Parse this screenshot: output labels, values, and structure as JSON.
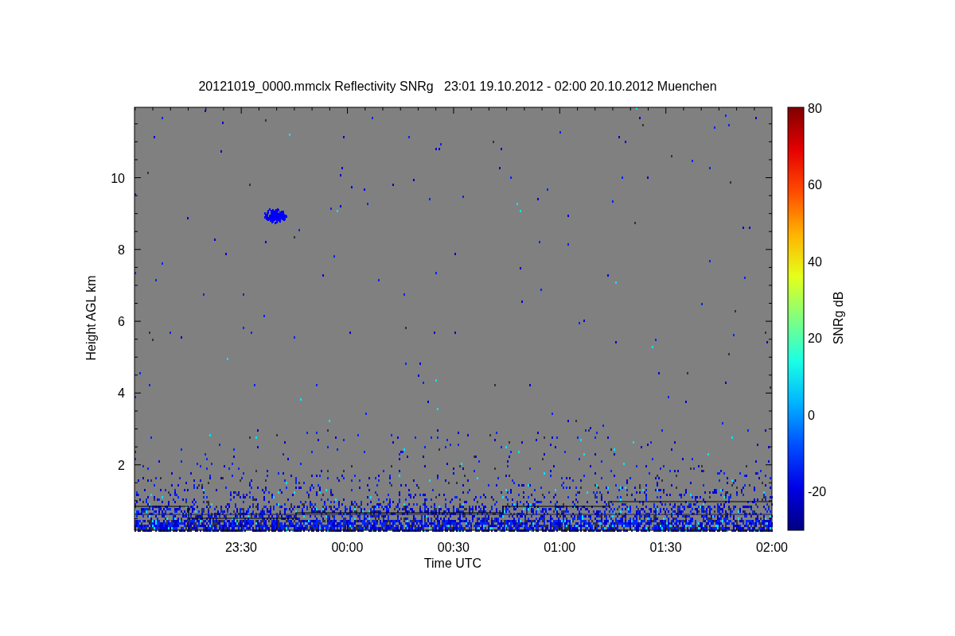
{
  "title": "20121019_0000.mmclx Reflectivity SNRg   23:01 19.10.2012 - 02:00 20.10.2012 Muenchen",
  "y_axis": {
    "label": "Height AGL km",
    "ticks": [
      "10",
      "8",
      "6",
      "4",
      "2"
    ]
  },
  "x_axis": {
    "label": "Time UTC",
    "ticks": [
      "23:30",
      "00:00",
      "00:30",
      "01:00",
      "01:30",
      "02:00"
    ]
  },
  "colorbar": {
    "label": "SNRg dB",
    "ticks": [
      "80",
      "60",
      "40",
      "20",
      "0",
      "-20"
    ]
  }
}
